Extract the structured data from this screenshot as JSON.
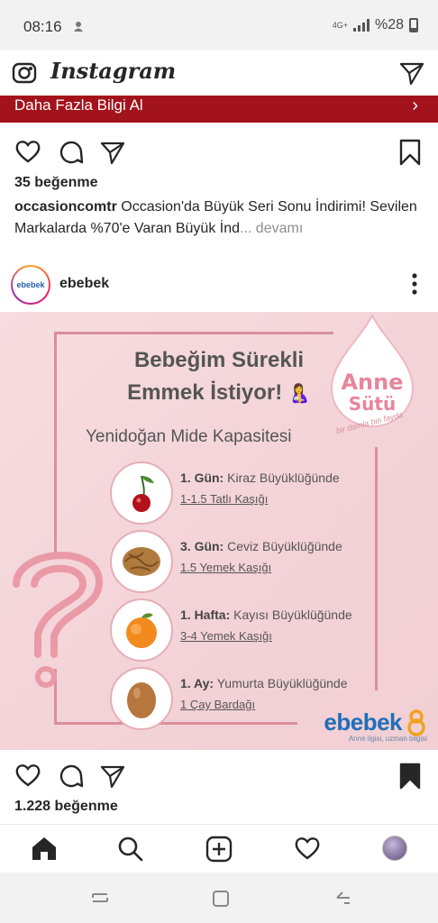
{
  "status_bar": {
    "time": "08:16",
    "network": "4G+",
    "battery": "%28"
  },
  "header": {
    "logo": "Instagram",
    "camera_icon": "camera-icon",
    "direct_icon": "send-icon"
  },
  "ad_bar": {
    "label": "Daha Fazla Bilgi Al",
    "chevron": "›",
    "color": "#a3131c"
  },
  "previous_post": {
    "likes": "35 beğenme",
    "caption_user": "occasioncomtr",
    "caption_text": " Occasion'da Büyük Seri Sonu İndirimi! Sevilen Markalarda %70'e Varan Büyük İnd",
    "caption_more": "... devamı"
  },
  "post": {
    "username": "ebebek",
    "avatar_text": "ebebek",
    "image": {
      "title_line1": "Bebeğim Sürekli",
      "title_line2": "Emmek İstiyor!",
      "emoji": "🤱",
      "subtitle": "Yenidoğan Mide Kapasitesi",
      "drop_word1": "Anne",
      "drop_word2": "Sütü",
      "drop_tagline": "bir damla bin fayda",
      "stages": [
        {
          "period": "1. Gün:",
          "desc": " Kiraz Büyüklüğünde",
          "amount": "1-1.5 Tatlı Kaşığı",
          "icon": "cherry-icon"
        },
        {
          "period": "3. Gün:",
          "desc": " Ceviz Büyüklüğünde",
          "amount": "1.5 Yemek Kaşığı",
          "icon": "walnut-icon"
        },
        {
          "period": "1. Hafta:",
          "desc": "  Kayısı Büyüklüğünde",
          "amount": "3-4 Yemek Kaşığı",
          "icon": "apricot-icon"
        },
        {
          "period": "1. Ay:",
          "desc": " Yumurta Büyüklüğünde",
          "amount": "1 Çay Bardağı",
          "icon": "egg-icon"
        }
      ],
      "brand_name": "ebebek",
      "brand_slogan": "Anne ilgisi, uzman bilgisi"
    },
    "likes": "1.228 beğenme"
  },
  "bottom_nav": {
    "items": [
      "home-icon",
      "search-icon",
      "add-post-icon",
      "activity-heart-icon",
      "profile-avatar"
    ]
  },
  "android_nav": {
    "items": [
      "recent-apps-icon",
      "home-button-icon",
      "back-icon"
    ]
  },
  "colors": {
    "accent": "#a3131c",
    "brand_blue": "#1f6fb8",
    "pink": "#e9849a"
  }
}
